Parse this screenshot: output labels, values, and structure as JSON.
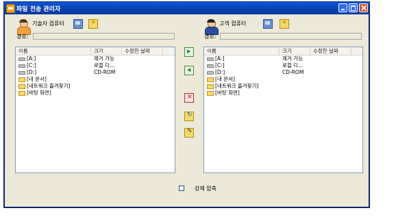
{
  "window": {
    "title": "파일 전송 관리자"
  },
  "left_panel": {
    "header_label": "기술자 컴퓨터",
    "path_label": "경로:",
    "path_value": "",
    "columns": [
      "이름",
      "크기",
      "수정한 날짜"
    ],
    "rows": [
      {
        "icon": "drive-icon",
        "name": "[A:]",
        "size": "제거 가능",
        "date": ""
      },
      {
        "icon": "drive-icon",
        "name": "[C:]",
        "size": "로컬 디...",
        "date": ""
      },
      {
        "icon": "drive-icon",
        "name": "[D:]",
        "size": "CD-ROM",
        "date": ""
      },
      {
        "icon": "folder-icon",
        "name": "[내 문서]",
        "size": "",
        "date": ""
      },
      {
        "icon": "folder-icon",
        "name": "[네트워크 즐겨찾기]",
        "size": "",
        "date": ""
      },
      {
        "icon": "folder-icon",
        "name": "[바탕 화면]",
        "size": "",
        "date": ""
      }
    ]
  },
  "right_panel": {
    "header_label": "고객 컴퓨터",
    "path_label": "경로:",
    "path_value": "",
    "columns": [
      "이름",
      "크기",
      "수정한 날짜"
    ],
    "rows": [
      {
        "icon": "drive-icon",
        "name": "[A:]",
        "size": "제거 가능",
        "date": ""
      },
      {
        "icon": "drive-icon",
        "name": "[C:]",
        "size": "로컬 디...",
        "date": ""
      },
      {
        "icon": "drive-icon",
        "name": "[D:]",
        "size": "CD-ROM",
        "date": ""
      },
      {
        "icon": "folder-icon",
        "name": "[내 문서]",
        "size": "",
        "date": ""
      },
      {
        "icon": "folder-icon",
        "name": "[네트워크 즐겨찾기]",
        "size": "",
        "date": ""
      },
      {
        "icon": "folder-icon",
        "name": "[바탕 화면]",
        "size": "",
        "date": ""
      }
    ]
  },
  "footer": {
    "force_compress_label": "강제 압축",
    "force_compress_checked": false
  },
  "colors": {
    "titlebar": "#0a5ad9",
    "client_bg": "#ece9d8",
    "list_border": "#7f9db9"
  }
}
